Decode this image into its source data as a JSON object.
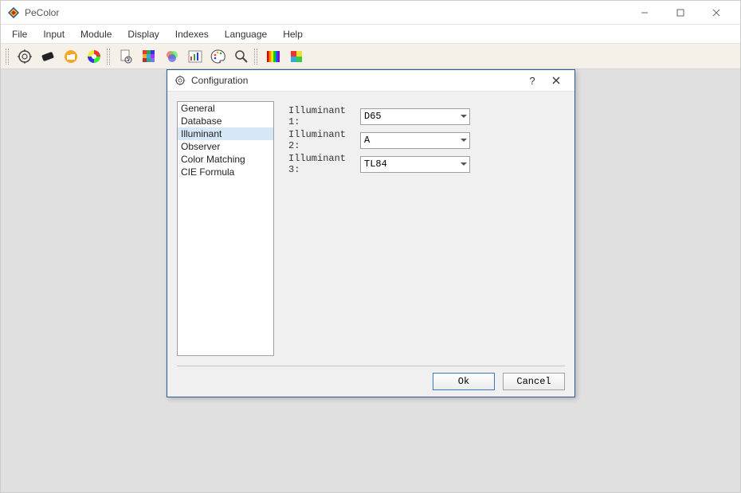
{
  "window": {
    "title": "PeColor"
  },
  "menu": {
    "items": [
      "File",
      "Input",
      "Module",
      "Display",
      "Indexes",
      "Language",
      "Help"
    ]
  },
  "toolbar": {
    "icons": [
      "gear-star-icon",
      "swatch-icon",
      "folder-icon",
      "color-circle-icon",
      "palette-doc-icon",
      "grid-icon",
      "venn-icon",
      "chart-icon",
      "palette-icon",
      "magnifier-icon",
      "spectrum-icon",
      "color-block-icon"
    ]
  },
  "dialog": {
    "title": "Configuration",
    "categories": [
      "General",
      "Database",
      "Illuminant",
      "Observer",
      "Color Matching",
      "CIE Formula"
    ],
    "selected_category_index": 2,
    "illuminant": {
      "rows": [
        {
          "label": "Illuminant 1:",
          "value": "D65"
        },
        {
          "label": "Illuminant 2:",
          "value": "A"
        },
        {
          "label": "Illuminant 3:",
          "value": "TL84"
        }
      ]
    },
    "buttons": {
      "ok": "Ok",
      "cancel": "Cancel"
    }
  }
}
